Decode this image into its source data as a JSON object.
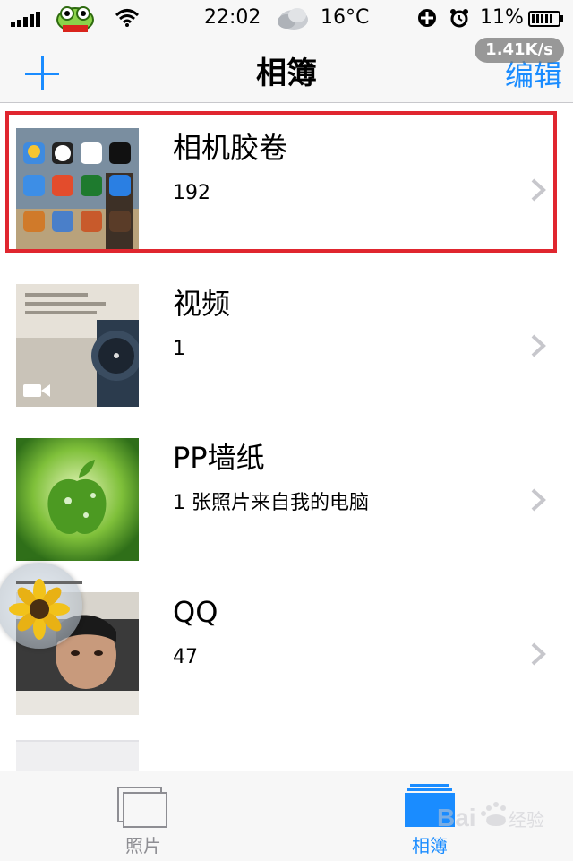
{
  "status_bar": {
    "time": "22:02",
    "temperature": "16°C",
    "battery": "11%",
    "icons": [
      "signal-icon",
      "app-badge-icon",
      "wifi-icon",
      "cloud-icon",
      "add-circle-icon",
      "alarm-icon",
      "battery-icon"
    ]
  },
  "nav": {
    "title": "相簿",
    "edit_label": "编辑",
    "add_icon": "plus-icon",
    "network_speed": "1.41K/s"
  },
  "albums": [
    {
      "name": "相机胶卷",
      "count": "192",
      "thumb": "home-screen-thumbnail"
    },
    {
      "name": "视频",
      "count": "1",
      "thumb": "watch-video-thumbnail"
    },
    {
      "name": "PP墙纸",
      "count": "1 张照片来自我的电脑",
      "thumb": "apple-wallpaper-thumbnail"
    },
    {
      "name": "QQ",
      "count": "47",
      "thumb": "portrait-thumbnail"
    }
  ],
  "tabs": [
    {
      "label": "照片",
      "icon": "photos-tab-icon",
      "active": false
    },
    {
      "label": "相簿",
      "icon": "albums-tab-icon",
      "active": true
    }
  ],
  "colors": {
    "accent": "#1a8cff",
    "highlight": "#e0262f",
    "bar_background": "#f7f7f7"
  },
  "watermark": "Bai 经验"
}
